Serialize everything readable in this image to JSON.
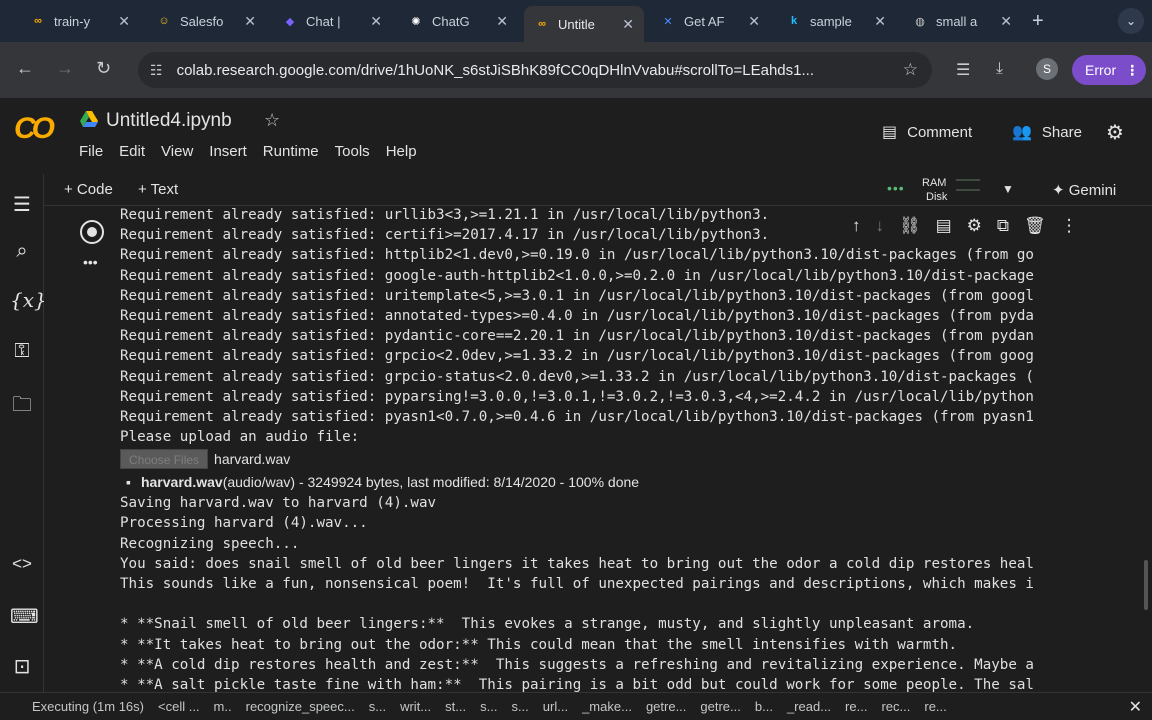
{
  "browser": {
    "tabs": [
      {
        "title": "train-y",
        "icon": "link-icon",
        "color": "#f9ab00",
        "active": false
      },
      {
        "title": "Salesfo",
        "icon": "emoji-icon",
        "color": "#fbc02d",
        "active": false
      },
      {
        "title": "Chat |",
        "icon": "chat-icon",
        "color": "#7b61ff",
        "active": false
      },
      {
        "title": "ChatG",
        "icon": "openai-icon",
        "color": "#ffffff",
        "active": false
      },
      {
        "title": "Untitle",
        "icon": "colab-icon",
        "color": "#f9ab00",
        "active": true
      },
      {
        "title": "Get AF",
        "icon": "butterfly-icon",
        "color": "#4a8cff",
        "active": false
      },
      {
        "title": "sample",
        "icon": "k-icon",
        "color": "#20beff",
        "active": false
      },
      {
        "title": "small a",
        "icon": "globe-icon",
        "color": "#c4c7c5",
        "active": false
      }
    ],
    "url": "colab.research.google.com/drive/1hUoNK_s6stJiSBhK89fCC0qDHlnVvabu#scrollTo=LEahds1...",
    "profile_initial": "S",
    "error_label": "Error"
  },
  "colab": {
    "notebook_title": "Untitled4.ipynb",
    "menu": [
      "File",
      "Edit",
      "View",
      "Insert",
      "Runtime",
      "Tools",
      "Help"
    ],
    "comment_label": "Comment",
    "share_label": "Share",
    "add_code_label": "+ Code",
    "add_text_label": "+ Text",
    "ram_label": "RAM",
    "disk_label": "Disk",
    "gemini_label": "Gemini"
  },
  "output": {
    "req_lines": [
      "Requirement already satisfied: urllib3<3,>=1.21.1 in /usr/local/lib/python3.",
      "Requirement already satisfied: certifi>=2017.4.17 in /usr/local/lib/python3.",
      "Requirement already satisfied: httplib2<1.dev0,>=0.19.0 in /usr/local/lib/python3.10/dist-packages (from go",
      "Requirement already satisfied: google-auth-httplib2<1.0.0,>=0.2.0 in /usr/local/lib/python3.10/dist-package",
      "Requirement already satisfied: uritemplate<5,>=3.0.1 in /usr/local/lib/python3.10/dist-packages (from googl",
      "Requirement already satisfied: annotated-types>=0.4.0 in /usr/local/lib/python3.10/dist-packages (from pyda",
      "Requirement already satisfied: pydantic-core==2.20.1 in /usr/local/lib/python3.10/dist-packages (from pydan",
      "Requirement already satisfied: grpcio<2.0dev,>=1.33.2 in /usr/local/lib/python3.10/dist-packages (from goog",
      "Requirement already satisfied: grpcio-status<2.0.dev0,>=1.33.2 in /usr/local/lib/python3.10/dist-packages (",
      "Requirement already satisfied: pyparsing!=3.0.0,!=3.0.1,!=3.0.2,!=3.0.3,<4,>=2.4.2 in /usr/local/lib/python",
      "Requirement already satisfied: pyasn1<0.7.0,>=0.4.6 in /usr/local/lib/python3.10/dist-packages (from pyasn1"
    ],
    "upload_prompt": "Please upload an audio file:",
    "choose_files_label": "Choose Files",
    "chosen_file": "harvard.wav",
    "file_name": "harvard.wav",
    "file_info": "(audio/wav) - 3249924 bytes, last modified: 8/14/2020 - 100% done",
    "after_lines": [
      "Saving harvard.wav to harvard (4).wav",
      "Processing harvard (4).wav...",
      "Recognizing speech...",
      "You said: does snail smell of old beer lingers it takes heat to bring out the odor a cold dip restores heal",
      "This sounds like a fun, nonsensical poem!  It's full of unexpected pairings and descriptions, which makes i"
    ],
    "poem_lines": [
      "* **Snail smell of old beer lingers:**  This evokes a strange, musty, and slightly unpleasant aroma.",
      "* **It takes heat to bring out the odor:** This could mean that the smell intensifies with warmth.",
      "* **A cold dip restores health and zest:**  This suggests a refreshing and revitalizing experience. Maybe a",
      "* **A salt pickle taste fine with ham:**  This pairing is a bit odd but could work for some people. The sal"
    ]
  },
  "statusbar": {
    "executing": "Executing (1m 16s)",
    "items": [
      "<cell ...",
      "m..",
      "recognize_speec...",
      "s...",
      "writ...",
      "st...",
      "s...",
      "s...",
      "url...",
      "_make...",
      "getre...",
      "getre...",
      "b...",
      "_read...",
      "re...",
      "rec...",
      "re..."
    ]
  }
}
